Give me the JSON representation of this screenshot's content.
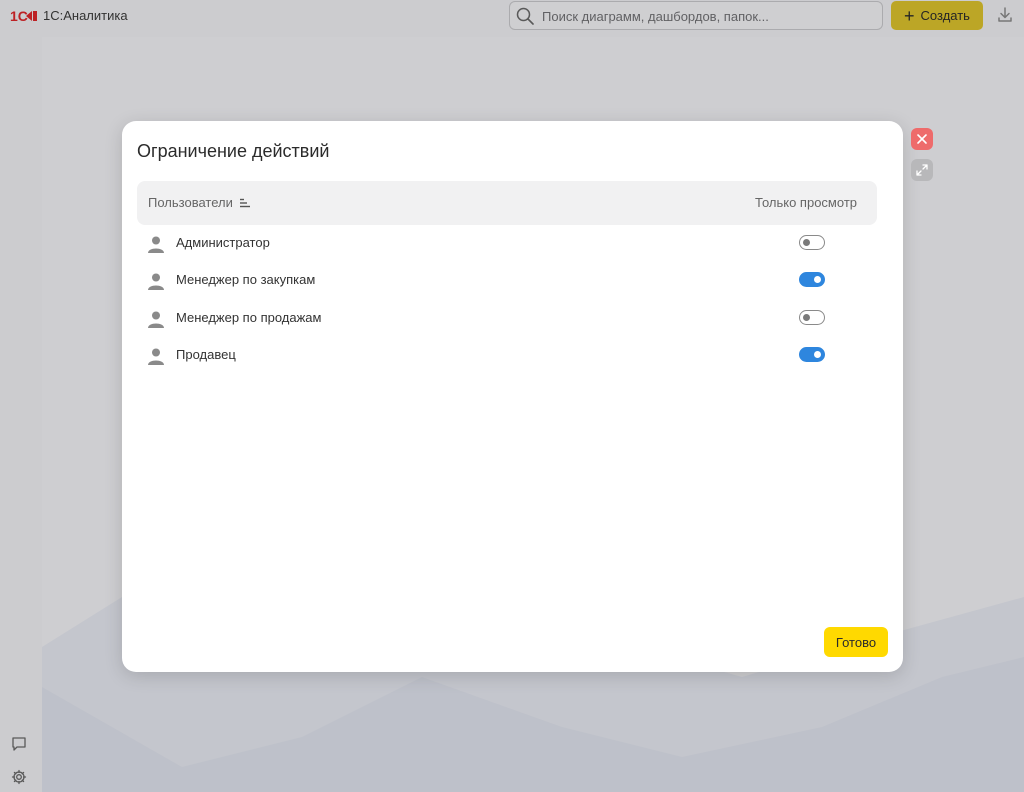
{
  "app": {
    "logo_text": "1С",
    "title": "1С:Аналитика"
  },
  "header": {
    "search_placeholder": "Поиск диаграмм, дашбордов, папок...",
    "create_label": "Создать",
    "create_icon": "plus-icon",
    "download_icon": "download-icon"
  },
  "sidebar": {
    "icons": [
      "chat-icon",
      "gear-icon"
    ]
  },
  "modal": {
    "title": "Ограничение действий",
    "columns": {
      "users": "Пользователи",
      "view_only": "Только просмотр"
    },
    "rows": [
      {
        "name": "Администратор",
        "view_only": false
      },
      {
        "name": "Менеджер по закупкам",
        "view_only": true
      },
      {
        "name": "Менеджер по продажам",
        "view_only": false
      },
      {
        "name": "Продавец",
        "view_only": true
      }
    ],
    "done_label": "Готово"
  },
  "colors": {
    "accent_yellow": "#ffd900",
    "toggle_on": "#2e86de",
    "close_red": "#ee6b6b"
  }
}
